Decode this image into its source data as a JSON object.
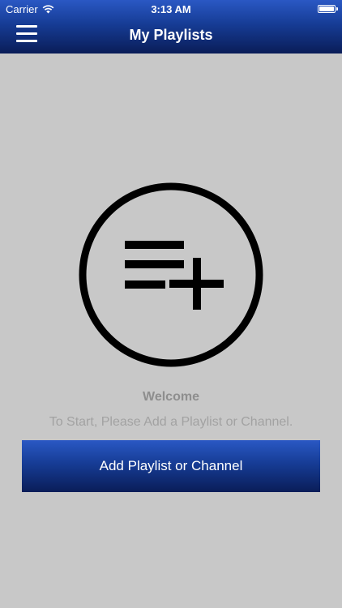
{
  "status_bar": {
    "carrier": "Carrier",
    "time": "3:13 AM",
    "wifi_icon": "wifi-icon",
    "battery_icon": "battery-full-icon",
    "battery_level": 1.0
  },
  "nav": {
    "menu_icon": "hamburger-menu-icon",
    "title": "My Playlists"
  },
  "empty_state": {
    "icon": "playlist-add-icon",
    "welcome": "Welcome",
    "instructions": "To Start, Please Add a Playlist or Channel."
  },
  "add_button": {
    "label": "Add Playlist or Channel"
  },
  "colors": {
    "background": "#c8c8c8",
    "accent_top": "#2a58c4",
    "accent_bottom": "#0a1d58",
    "icon": "#000000",
    "muted_text": "#8e8e8e"
  }
}
